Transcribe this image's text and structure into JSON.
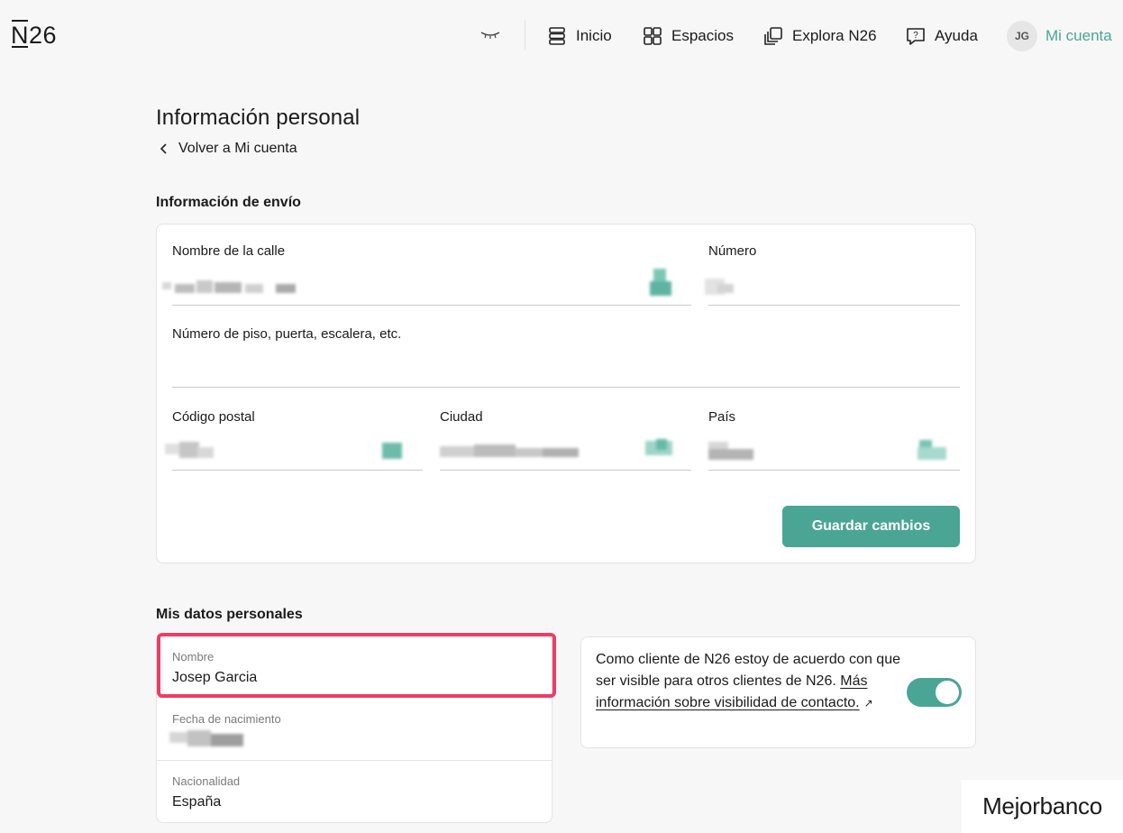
{
  "header": {
    "logo": "N26",
    "nav": [
      {
        "label": "Inicio",
        "icon": "home-stack-icon"
      },
      {
        "label": "Espacios",
        "icon": "grid-icon"
      },
      {
        "label": "Explora N26",
        "icon": "layers-icon"
      },
      {
        "label": "Ayuda",
        "icon": "help-chat-icon"
      }
    ],
    "avatar_initials": "JG",
    "account_label": "Mi cuenta",
    "privacy_icon": "closed-eye-icon"
  },
  "page": {
    "title": "Información personal",
    "back_label": "Volver a Mi cuenta"
  },
  "shipping": {
    "section_title": "Información de envío",
    "street_label": "Nombre de la calle",
    "number_label": "Número",
    "floor_label": "Número de piso, puerta, escalera, etc.",
    "postal_label": "Código postal",
    "city_label": "Ciudad",
    "country_label": "País",
    "save_label": "Guardar cambios"
  },
  "personal": {
    "section_title": "Mis datos personales",
    "name_label": "Nombre",
    "name_value": "Josep Garcia",
    "birth_label": "Fecha de nacimiento",
    "nationality_label": "Nacionalidad",
    "nationality_value": "España",
    "visibility_text": "Como cliente de N26 estoy de acuerdo con que ser visible para otros clientes de N26.",
    "visibility_link": "Más información sobre visibilidad de contacto.",
    "visibility_enabled": true
  },
  "watermark": "Mejorbanco",
  "colors": {
    "accent": "#4aa595",
    "highlight": "#ec3d66",
    "background": "#f7f7f7"
  }
}
